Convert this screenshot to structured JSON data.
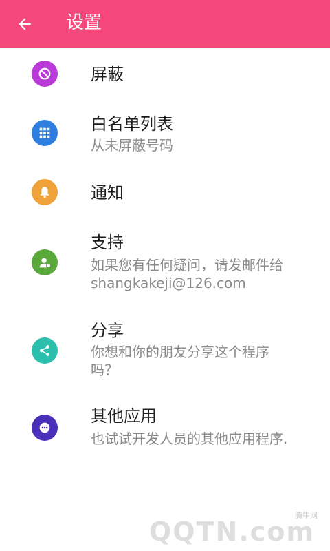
{
  "appbar": {
    "back_icon": "arrow-back-icon",
    "title": "设置"
  },
  "items": [
    {
      "icon": "block-icon",
      "color": "#b93ad9",
      "title": "屏蔽",
      "subtitle": ""
    },
    {
      "icon": "grid-icon",
      "color": "#2f7fe0",
      "title": "白名单列表",
      "subtitle": "从未屏蔽号码"
    },
    {
      "icon": "bell-icon",
      "color": "#f0a23a",
      "title": "通知",
      "subtitle": ""
    },
    {
      "icon": "support-agent-icon",
      "color": "#5aa83a",
      "title": "支持",
      "subtitle": "如果您有任何疑问，请发邮件给 shangkakeji@126.com"
    },
    {
      "icon": "share-icon",
      "color": "#2bbfae",
      "title": "分享",
      "subtitle": "你想和你的朋友分享这个程序吗？"
    },
    {
      "icon": "more-icon",
      "color": "#4a2fb8",
      "title": "其他应用",
      "subtitle": "也试试开发人员的其他应用程序."
    }
  ],
  "watermark": {
    "small": "腾牛网",
    "big": "QQTN.com"
  }
}
